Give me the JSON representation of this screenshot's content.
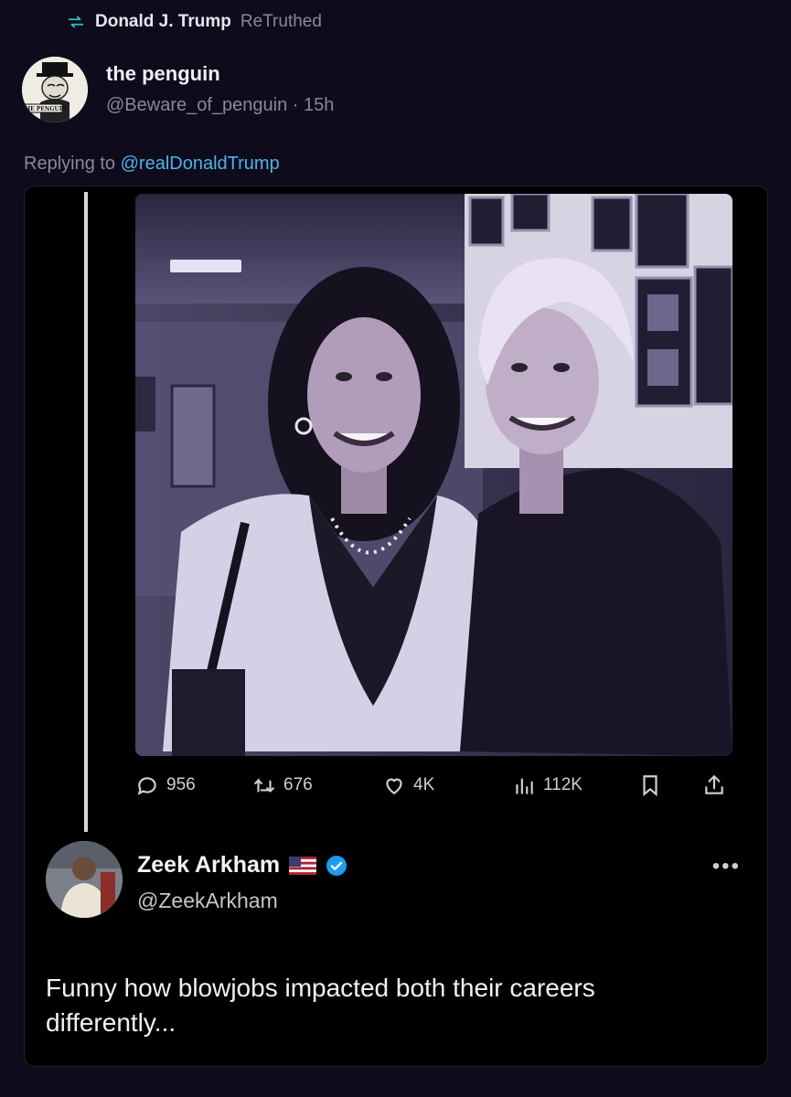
{
  "retruth": {
    "name": "Donald J. Trump",
    "verb": "ReTruthed"
  },
  "author": {
    "name": "the penguin",
    "handle": "@Beware_of_penguin",
    "time": "15h",
    "avatar_text": "THE PENGUIN"
  },
  "reply": {
    "prefix": "Replying to",
    "mention": "@realDonaldTrump"
  },
  "embedded_post": {
    "actions": {
      "replies": "956",
      "reposts": "676",
      "likes": "4K",
      "views": "112K"
    },
    "quoted": {
      "name": "Zeek Arkham",
      "handle": "@ZeekArkham",
      "text": "Funny how blowjobs impacted both their careers differently..."
    }
  },
  "colors": {
    "background": "#0d0b1c",
    "mention": "#4fb4e8",
    "verified": "#1d9bf0",
    "retruth_icon": "#2ec4b6"
  }
}
